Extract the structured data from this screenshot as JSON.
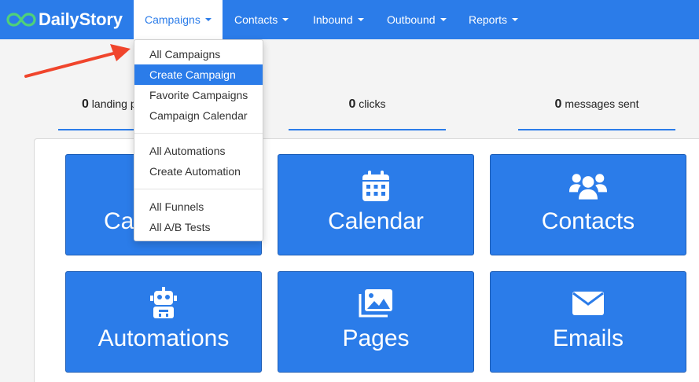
{
  "brand": {
    "name": "DailyStory",
    "accent": "#2b7ce9",
    "logo_icon": "infinity-logo-icon"
  },
  "nav": {
    "campaigns": "Campaigns",
    "contacts": "Contacts",
    "inbound": "Inbound",
    "outbound": "Outbound",
    "reports": "Reports"
  },
  "dropdown": {
    "group1": [
      "All Campaigns",
      "Create Campaign",
      "Favorite Campaigns",
      "Campaign Calendar"
    ],
    "group2": [
      "All Automations",
      "Create Automation"
    ],
    "group3": [
      "All Funnels",
      "All A/B Tests"
    ],
    "selected": "Create Campaign"
  },
  "stats": {
    "landing": {
      "num": "0",
      "label": "landing p"
    },
    "clicks": {
      "num": "0",
      "label": "clicks"
    },
    "messages": {
      "num": "0",
      "label": "messages sent"
    }
  },
  "tiles": {
    "campaigns": {
      "label": "Ca"
    },
    "calendar": {
      "label": "Calendar",
      "icon": "calendar-icon"
    },
    "contacts": {
      "label": "Contacts",
      "icon": "users-icon"
    },
    "automations": {
      "label": "Automations",
      "icon": "robot-icon"
    },
    "pages": {
      "label": "Pages",
      "icon": "images-icon"
    },
    "emails": {
      "label": "Emails",
      "icon": "envelope-icon"
    }
  },
  "annotation": {
    "color": "#f0452c",
    "icon": "red-arrow-icon"
  }
}
